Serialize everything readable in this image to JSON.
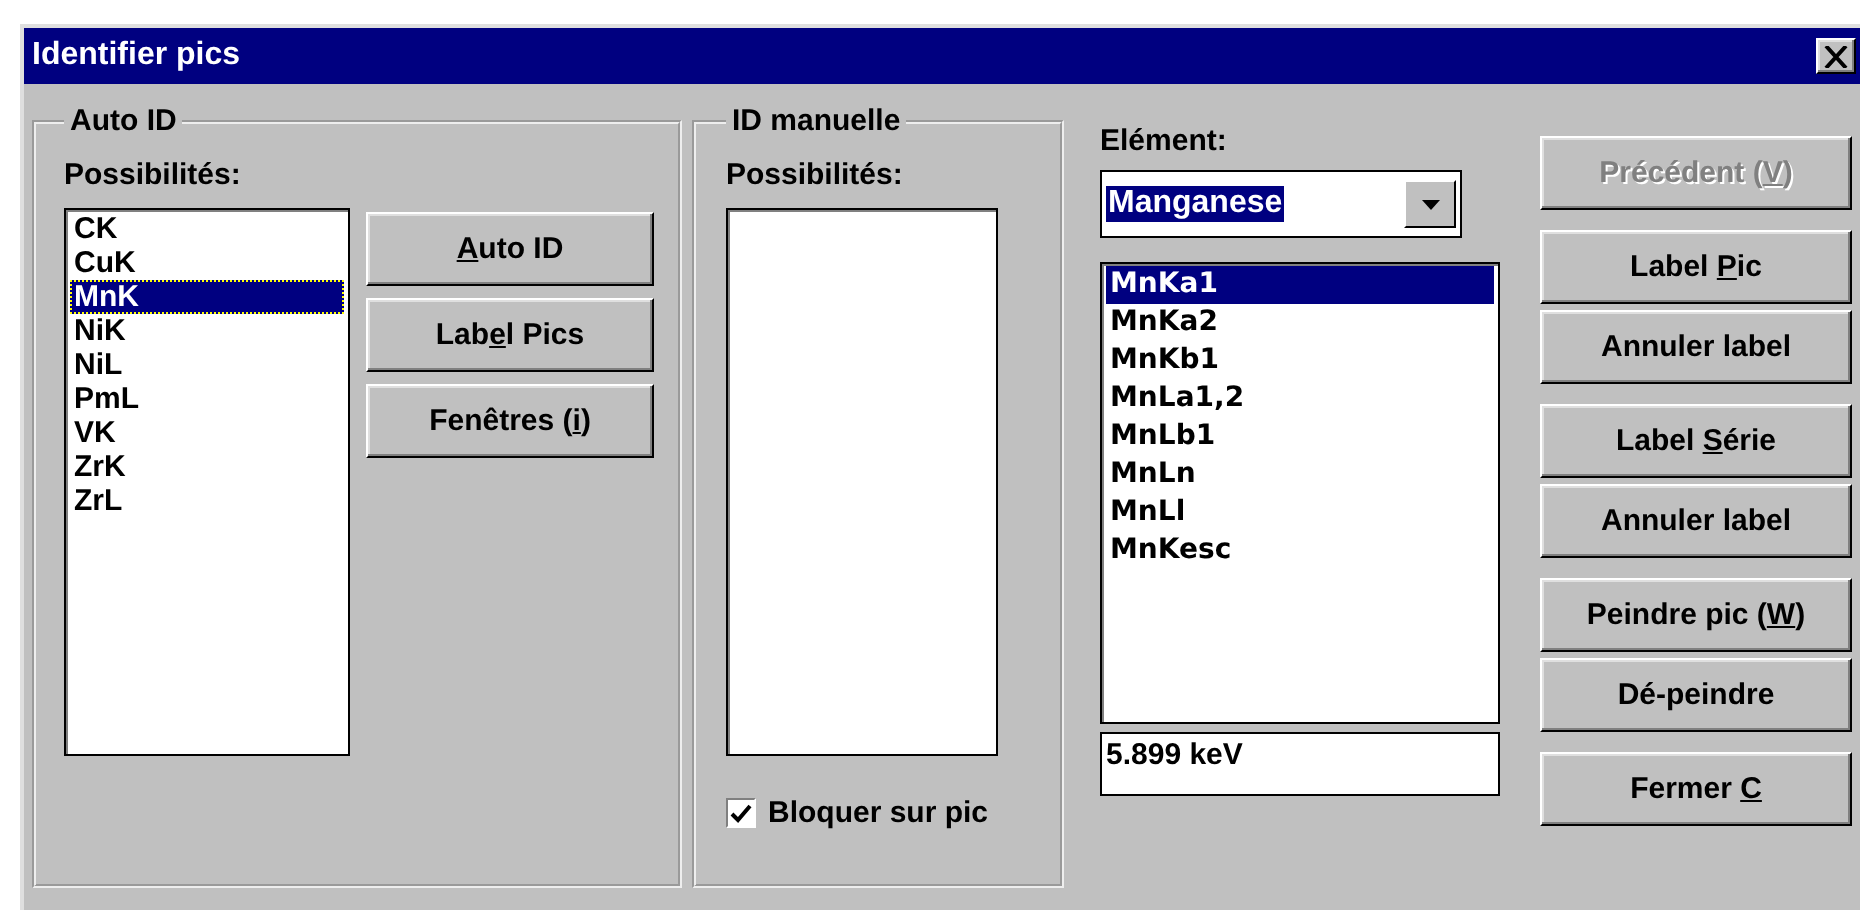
{
  "window": {
    "title": "Identifier pics"
  },
  "auto_id": {
    "title": "Auto ID",
    "list_label": "Possibilités:",
    "items": [
      {
        "label": "CK",
        "selected": false
      },
      {
        "label": "CuK",
        "selected": false
      },
      {
        "label": "MnK",
        "selected": true
      },
      {
        "label": "NiK",
        "selected": false
      },
      {
        "label": "NiL",
        "selected": false
      },
      {
        "label": "PmL",
        "selected": false
      },
      {
        "label": "VK",
        "selected": false
      },
      {
        "label": "ZrK",
        "selected": false
      },
      {
        "label": "ZrL",
        "selected": false
      }
    ],
    "buttons": [
      {
        "key": "A",
        "post": "uto ID",
        "disabled": false
      },
      {
        "pre": "Lab",
        "key": "e",
        "post": "l Pics",
        "disabled": false
      },
      {
        "pre": "Fenêtres (",
        "key": "i",
        "post": ")",
        "disabled": false
      }
    ]
  },
  "manual_id": {
    "title": "ID manuelle",
    "list_label": "Possibilités:",
    "checkbox": {
      "label": "Bloquer sur pic",
      "checked": true
    }
  },
  "element": {
    "label": "Elément:",
    "combo": {
      "value": "Manganese"
    },
    "lines": [
      {
        "label": "MnKa1",
        "selected": true
      },
      {
        "label": "MnKa2",
        "selected": false
      },
      {
        "label": "MnKb1",
        "selected": false
      },
      {
        "label": "MnLa1,2",
        "selected": false
      },
      {
        "label": "MnLb1",
        "selected": false
      },
      {
        "label": "MnLn",
        "selected": false
      },
      {
        "label": "MnLl",
        "selected": false
      },
      {
        "label": "MnKesc",
        "selected": false
      }
    ],
    "energy": "5.899 keV"
  },
  "button_groups": [
    [
      {
        "pre": "Précédent (",
        "key": "V",
        "post": ")",
        "disabled": true
      }
    ],
    [
      {
        "pre": "Label ",
        "key": "P",
        "post": "ic",
        "disabled": false
      },
      {
        "pre": "Annuler label",
        "disabled": false
      }
    ],
    [
      {
        "pre": "Label ",
        "key": "S",
        "post": "érie",
        "disabled": false
      },
      {
        "pre": "Annuler label",
        "disabled": false
      }
    ],
    [
      {
        "pre": "Peindre pic (",
        "key": "W",
        "post": ")",
        "disabled": false
      },
      {
        "pre": "Dé-peindre",
        "disabled": false
      }
    ],
    [
      {
        "pre": "Fermer ",
        "key": "C",
        "disabled": false
      }
    ]
  ]
}
